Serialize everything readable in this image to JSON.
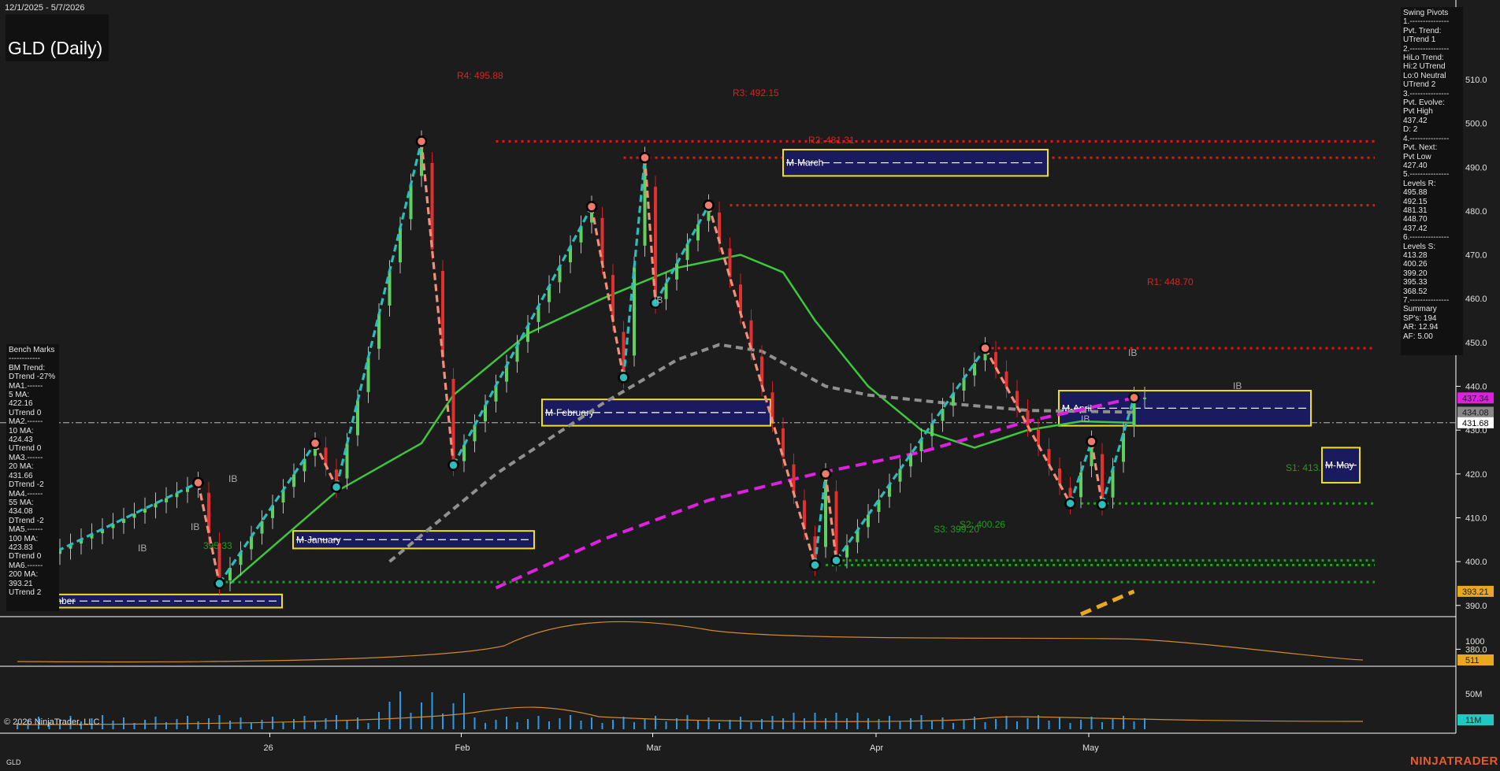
{
  "header": {
    "date_range": "12/1/2025 - 5/7/2026",
    "title": "GLD (Daily)"
  },
  "footer": {
    "copyright": "© 2026 NinjaTrader, LLC",
    "symbol": "GLD",
    "brand": "NINJATRADER"
  },
  "swing_pivots_panel": {
    "lines": [
      "Swing Pivots",
      "1.---------------",
      "Pvt. Trend:",
      "UTrend 1",
      "2.---------------",
      "HiLo Trend:",
      "Hi:2 UTrend",
      "Lo:0 Neutral",
      "UTrend 2",
      "3.---------------",
      "Pvt. Evolve:",
      "Pvt High",
      "437.42",
      "D: 2",
      "4.---------------",
      "Pvt. Next:",
      "Pvt Low",
      "427.40",
      "5.---------------",
      "Levels R:",
      "495.88",
      "492.15",
      "481.31",
      "448.70",
      "437.42",
      "6.---------------",
      "Levels S:",
      "413.28",
      "400.26",
      "399.20",
      "395.33",
      "368.52",
      "7.---------------",
      "Summary",
      "SP's: 194",
      "AR: 12.94",
      "AF: 5.00"
    ]
  },
  "bench_marks_panel": {
    "lines": [
      "Bench Marks",
      "------------",
      "BM Trend:",
      "DTrend -27%",
      "MA1.------",
      "5 MA:",
      "422.16",
      "UTrend 0",
      "MA2.------",
      "10 MA:",
      "424.43",
      "UTrend 0",
      "MA3.------",
      "20 MA:",
      "431.66",
      "DTrend -2",
      "MA4.------",
      "55 MA:",
      "434.08",
      "DTrend -2",
      "MA5.------",
      "100 MA:",
      "423.83",
      "DTrend 0",
      "MA6.------",
      "200 MA:",
      "393.21",
      "UTrend 2"
    ]
  },
  "price_axis": {
    "min": 370,
    "max": 515,
    "ticks": [
      380,
      390,
      400,
      410,
      420,
      430,
      440,
      450,
      460,
      470,
      480,
      490,
      500,
      510
    ],
    "tags": [
      {
        "label": "437.34",
        "value": 437.34,
        "color": "#e020e0"
      },
      {
        "label": "434.08",
        "value": 434.08,
        "color": "#888888"
      },
      {
        "label": "431.68",
        "value": 431.68,
        "color": "#ffffff"
      },
      {
        "label": "393.21",
        "value": 393.21,
        "color": "#e8a820"
      }
    ]
  },
  "time_axis": {
    "labels": [
      {
        "label": "26",
        "day": 23
      },
      {
        "label": "Feb",
        "day": 41
      },
      {
        "label": "Mar",
        "day": 59
      },
      {
        "label": "Apr",
        "day": 80
      },
      {
        "label": "May",
        "day": 100
      }
    ]
  },
  "oscillator_panel": {
    "tick": "1000",
    "tag": "511"
  },
  "volume_panel": {
    "tick": "50M",
    "tag": "11M"
  },
  "levels": {
    "resistance": [
      {
        "label": "R4: 495.88",
        "value": 495.88
      },
      {
        "label": "R3: 492.15",
        "value": 492.15
      },
      {
        "label": "R2: 481.31",
        "value": 481.31
      },
      {
        "label": "R1: 448.70",
        "value": 448.7
      }
    ],
    "support": [
      {
        "label": "S1: 413.28",
        "value": 413.28
      },
      {
        "label": "S2: 400.26",
        "value": 400.26
      },
      {
        "label": "S3: 399.20",
        "value": 399.2
      },
      {
        "label": "395.33",
        "value": 395.33
      }
    ]
  },
  "monthly_boxes": [
    {
      "label": "M-December",
      "low": 389.5,
      "high": 392.5,
      "mid": 391
    },
    {
      "label": "M-January",
      "low": 403,
      "high": 407,
      "mid": 405
    },
    {
      "label": "M-February",
      "low": 431,
      "high": 437,
      "mid": 434
    },
    {
      "label": "M-March",
      "low": 488,
      "high": 494,
      "mid": 491
    },
    {
      "label": "M-April",
      "low": 431,
      "high": 439,
      "mid": 435
    },
    {
      "label": "M-May",
      "low": 418,
      "high": 426,
      "mid": 422
    }
  ],
  "ib_markers": [
    "IB",
    "IB",
    "IB",
    "IB",
    "IB",
    "IB",
    "IB"
  ],
  "chart_data": {
    "type": "line",
    "title": "GLD (Daily)",
    "x_range": [
      "12/1/2025",
      "5/7/2026"
    ],
    "ylim": [
      370,
      515
    ],
    "swing_pivots": [
      {
        "day": 0,
        "price": 398,
        "type": "low"
      },
      {
        "day": 17,
        "price": 418,
        "type": "high"
      },
      {
        "day": 19,
        "price": 395,
        "type": "low"
      },
      {
        "day": 28,
        "price": 427,
        "type": "high"
      },
      {
        "day": 30,
        "price": 417,
        "type": "low"
      },
      {
        "day": 38,
        "price": 495.88,
        "type": "high"
      },
      {
        "day": 41,
        "price": 422,
        "type": "low"
      },
      {
        "day": 54,
        "price": 481,
        "type": "high"
      },
      {
        "day": 57,
        "price": 442,
        "type": "low"
      },
      {
        "day": 59,
        "price": 492.15,
        "type": "high"
      },
      {
        "day": 60,
        "price": 459,
        "type": "low"
      },
      {
        "day": 65,
        "price": 481.31,
        "type": "high"
      },
      {
        "day": 75,
        "price": 399.2,
        "type": "low"
      },
      {
        "day": 76,
        "price": 420,
        "type": "high"
      },
      {
        "day": 77,
        "price": 400.26,
        "type": "low"
      },
      {
        "day": 91,
        "price": 448.7,
        "type": "high"
      },
      {
        "day": 99,
        "price": 413.28,
        "type": "low"
      },
      {
        "day": 101,
        "price": 427.4,
        "type": "high"
      },
      {
        "day": 102,
        "price": 413,
        "type": "low"
      },
      {
        "day": 105,
        "price": 437.42,
        "type": "high"
      }
    ],
    "moving_averages": [
      {
        "name": "20 MA",
        "color": "#3cc83c",
        "values": [
          [
            0,
            376
          ],
          [
            10,
            383
          ],
          [
            20,
            395
          ],
          [
            30,
            416
          ],
          [
            38,
            427
          ],
          [
            41,
            438
          ],
          [
            48,
            452
          ],
          [
            55,
            460
          ],
          [
            62,
            467
          ],
          [
            68,
            470
          ],
          [
            72,
            466
          ],
          [
            75,
            455
          ],
          [
            80,
            440
          ],
          [
            85,
            430
          ],
          [
            90,
            426
          ],
          [
            95,
            430
          ],
          [
            100,
            432
          ],
          [
            105,
            431.66
          ]
        ]
      },
      {
        "name": "55 MA",
        "color": "#909090",
        "values": [
          [
            5,
            370
          ],
          [
            15,
            376
          ],
          [
            25,
            384
          ],
          [
            35,
            400
          ],
          [
            45,
            420
          ],
          [
            55,
            436
          ],
          [
            62,
            446
          ],
          [
            66,
            449.5
          ],
          [
            70,
            448
          ],
          [
            76,
            440
          ],
          [
            80,
            438
          ],
          [
            88,
            436
          ],
          [
            95,
            434.5
          ],
          [
            105,
            434.08
          ]
        ]
      },
      {
        "name": "100 MA",
        "color": "#e020e0",
        "values": [
          [
            28,
            370
          ],
          [
            35,
            380
          ],
          [
            45,
            394
          ],
          [
            55,
            405
          ],
          [
            65,
            414
          ],
          [
            75,
            420
          ],
          [
            85,
            425
          ],
          [
            95,
            432
          ],
          [
            105,
            437.34
          ]
        ]
      },
      {
        "name": "200 MA",
        "color": "#e8a820",
        "values": [
          [
            72,
            370
          ],
          [
            80,
            376
          ],
          [
            90,
            382
          ],
          [
            100,
            388
          ],
          [
            105,
            393.21
          ]
        ]
      }
    ]
  }
}
